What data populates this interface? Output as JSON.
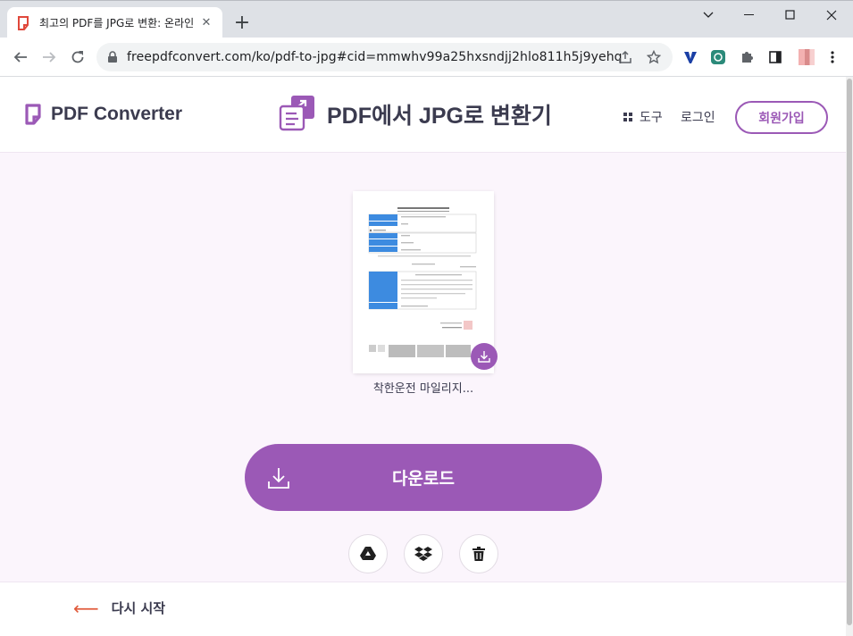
{
  "browser": {
    "tab_title": "최고의 PDF를 JPG로 변환: 온라인",
    "url": "freepdfconvert.com/ko/pdf-to-jpg#cid=mmwhv99a25hxsndjj2hlo811h5j9yehq"
  },
  "header": {
    "logo_text": "PDF Converter",
    "page_title": "PDF에서 JPG로 변환기",
    "tools_label": "도구",
    "login_label": "로그인",
    "signup_label": "회원가입"
  },
  "result": {
    "filename": "착한운전 마일리지...",
    "download_label": "다운로드"
  },
  "footer": {
    "restart_label": "다시 시작"
  },
  "colors": {
    "accent": "#9b59b6",
    "page_bg": "#fbf5fc",
    "text": "#3b3b4f",
    "restart_arrow": "#e05a3a"
  },
  "icons": [
    "pdf-converter-logo-icon",
    "convert-doc-icon",
    "grid-icon",
    "download-icon",
    "google-drive-icon",
    "dropbox-icon",
    "trash-icon",
    "left-arrow-icon"
  ]
}
